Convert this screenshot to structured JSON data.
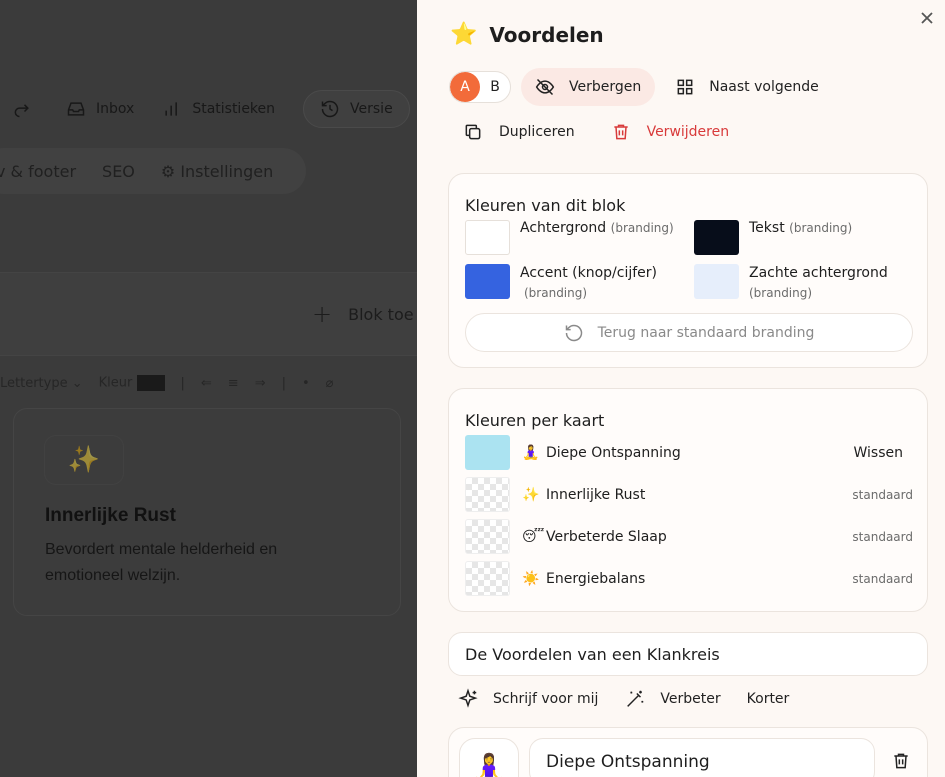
{
  "background": {
    "toolbar": {
      "inbox": "Inbox",
      "stats": "Statistieken",
      "versions": "Versie"
    },
    "tabs": {
      "header_footer": "v & footer",
      "seo": "SEO",
      "settings": "⚙ Instellingen"
    },
    "add_block": "Blok toe",
    "format_bar": {
      "font": "Lettertype",
      "color": "Kleur"
    },
    "card": {
      "icon": "✨",
      "title": "Innerlijke Rust",
      "description": "Bevordert mentale helderheid en emotioneel welzijn."
    }
  },
  "panel": {
    "icon": "⭐",
    "title": "Voordelen",
    "ab": {
      "a": "A",
      "b": "B"
    },
    "actions": {
      "hide": "Verbergen",
      "next_to": "Naast volgende",
      "duplicate": "Dupliceren",
      "delete": "Verwijderen"
    },
    "block_colors": {
      "heading": "Kleuren van dit blok",
      "tag": "(branding)",
      "items": [
        {
          "label": "Achtergrond",
          "color": "#ffffff"
        },
        {
          "label": "Tekst",
          "color": "#070d1a"
        },
        {
          "label": "Accent (knop/cijfer)",
          "color": "#3563e0"
        },
        {
          "label": "Zachte achtergrond",
          "color": "#e6eefb"
        }
      ],
      "reset": "Terug naar standaard branding"
    },
    "card_colors": {
      "heading": "Kleuren per kaart",
      "items": [
        {
          "emoji": "🧘‍♀️",
          "label": "Diepe Ontspanning",
          "action": "Wissen",
          "color": "#abe3f1"
        },
        {
          "emoji": "✨",
          "label": "Innerlijke Rust",
          "action": "standaard"
        },
        {
          "emoji": "😴",
          "label": "Verbeterde Slaap",
          "action": "standaard"
        },
        {
          "emoji": "☀️",
          "label": "Energiebalans",
          "action": "standaard"
        }
      ]
    },
    "section_title": "De Voordelen van een Klankreis",
    "ai": {
      "write": "Schrijf voor mij",
      "improve": "Verbeter",
      "shorter": "Korter"
    },
    "item": {
      "emoji": "🧘‍♀️",
      "value": "Diepe Ontspanning"
    }
  }
}
